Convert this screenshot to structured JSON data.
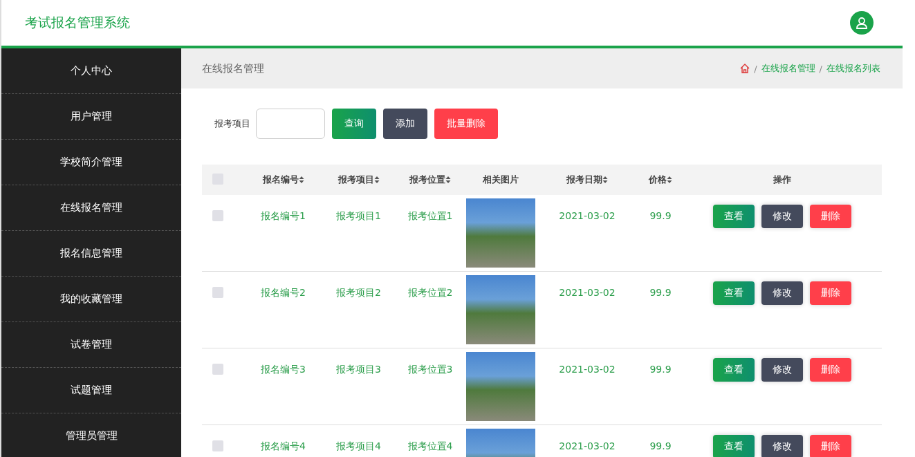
{
  "header": {
    "title": "考试报名管理系统"
  },
  "sidebar": {
    "items": [
      {
        "label": "个人中心"
      },
      {
        "label": "用户管理"
      },
      {
        "label": "学校简介管理"
      },
      {
        "label": "在线报名管理"
      },
      {
        "label": "报名信息管理"
      },
      {
        "label": "我的收藏管理"
      },
      {
        "label": "试卷管理"
      },
      {
        "label": "试题管理"
      },
      {
        "label": "管理员管理"
      }
    ]
  },
  "page_header": {
    "title": "在线报名管理",
    "breadcrumb": [
      {
        "separator": "/",
        "label": "在线报名管理"
      },
      {
        "separator": "/",
        "label": "在线报名列表"
      }
    ]
  },
  "search": {
    "label": "报考项目",
    "buttons": [
      {
        "label": "查询",
        "kind": "primary"
      },
      {
        "label": "添加",
        "kind": "dark"
      },
      {
        "label": "批量删除",
        "kind": "danger"
      }
    ]
  },
  "table": {
    "header_checked": false,
    "columns": [
      {
        "label": "报名编号",
        "sortable": true
      },
      {
        "label": "报考项目",
        "sortable": true
      },
      {
        "label": "报考位置",
        "sortable": true
      },
      {
        "label": "相关图片",
        "sortable": false
      },
      {
        "label": "报考日期",
        "sortable": true
      },
      {
        "label": "价格",
        "sortable": true
      },
      {
        "label": "操作",
        "sortable": false
      }
    ],
    "rows": [
      {
        "checked": false,
        "cells": [
          "报名编号1",
          "报考项目1",
          "报考位置1",
          "",
          "2021-03-02",
          "99.9"
        ],
        "actions": [
          {
            "label": "查看",
            "kind": "primary"
          },
          {
            "label": "修改",
            "kind": "dark"
          },
          {
            "label": "删除",
            "kind": "danger"
          }
        ]
      },
      {
        "checked": false,
        "cells": [
          "报名编号2",
          "报考项目2",
          "报考位置2",
          "",
          "2021-03-02",
          "99.9"
        ],
        "actions": [
          {
            "label": "查看",
            "kind": "primary"
          },
          {
            "label": "修改",
            "kind": "dark"
          },
          {
            "label": "删除",
            "kind": "danger"
          }
        ]
      },
      {
        "checked": false,
        "cells": [
          "报名编号3",
          "报考项目3",
          "报考位置3",
          "",
          "2021-03-02",
          "99.9"
        ],
        "actions": [
          {
            "label": "查看",
            "kind": "primary"
          },
          {
            "label": "修改",
            "kind": "dark"
          },
          {
            "label": "删除",
            "kind": "danger"
          }
        ]
      },
      {
        "checked": false,
        "cells": [
          "报名编号4",
          "报考项目4",
          "报考位置4",
          "",
          "2021-03-02",
          "99.9"
        ],
        "actions": [
          {
            "label": "查看",
            "kind": "primary"
          },
          {
            "label": "修改",
            "kind": "dark"
          },
          {
            "label": "删除",
            "kind": "danger"
          }
        ]
      }
    ]
  }
}
